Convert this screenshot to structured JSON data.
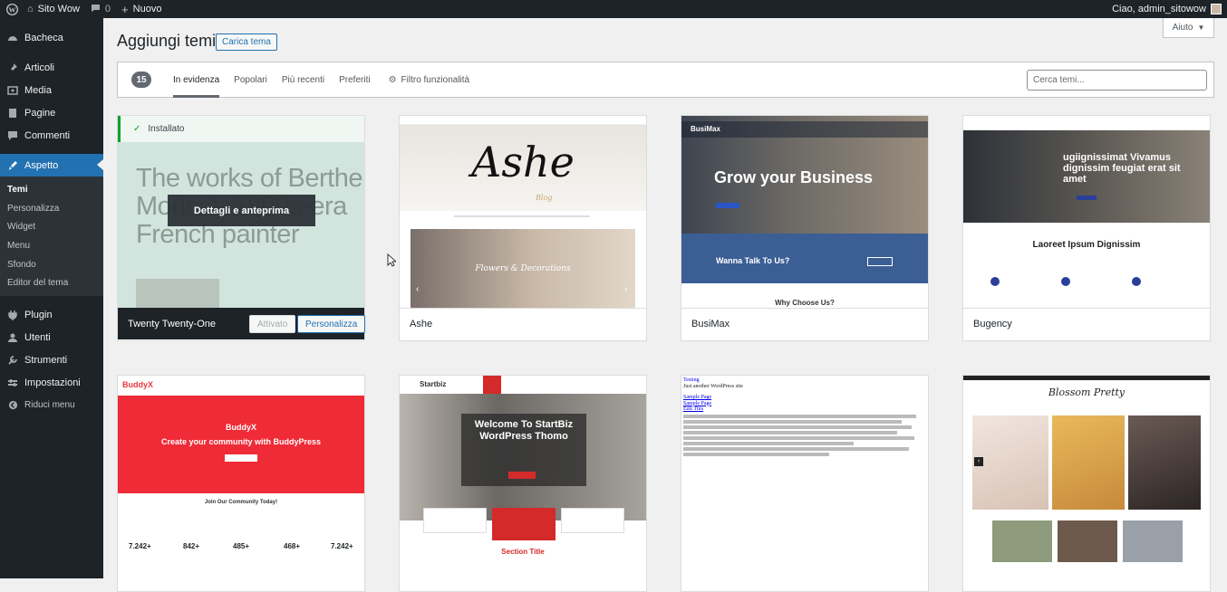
{
  "adminbar": {
    "site_name": "Sito Wow",
    "comments_count": "0",
    "new_label": "Nuovo",
    "greeting": "Ciao, admin_sitowow"
  },
  "sidebar": {
    "items": [
      {
        "label": "Bacheca",
        "icon": "dashboard-icon"
      },
      {
        "label": "Articoli",
        "icon": "pin-icon"
      },
      {
        "label": "Media",
        "icon": "media-icon"
      },
      {
        "label": "Pagine",
        "icon": "pages-icon"
      },
      {
        "label": "Commenti",
        "icon": "comments-icon"
      },
      {
        "label": "Aspetto",
        "icon": "appearance-icon"
      },
      {
        "label": "Plugin",
        "icon": "plugin-icon"
      },
      {
        "label": "Utenti",
        "icon": "users-icon"
      },
      {
        "label": "Strumenti",
        "icon": "tools-icon"
      },
      {
        "label": "Impostazioni",
        "icon": "settings-icon"
      },
      {
        "label": "Riduci menu",
        "icon": "collapse-icon"
      }
    ],
    "submenu": [
      "Temi",
      "Personalizza",
      "Widget",
      "Menu",
      "Sfondo",
      "Editor del tema"
    ]
  },
  "header": {
    "title": "Aggiungi temi",
    "upload_label": "Carica tema",
    "help_label": "Aiuto"
  },
  "filters": {
    "count": "15",
    "tabs": [
      "In evidenza",
      "Popolari",
      "Più recenti",
      "Preferiti"
    ],
    "feature_filter": "Filtro funzionalità",
    "search_placeholder": "Cerca temi..."
  },
  "themes": [
    {
      "name": "Twenty Twenty-One",
      "installed_label": "Installato",
      "details_label": "Dettagli e anteprima",
      "hero_text": "The works of Berthe Morisot, 1800s-era French painter",
      "activated_label": "Attivato",
      "customize_label": "Personalizza"
    },
    {
      "name": "Ashe",
      "logo": "Ashe",
      "logo_sub": "Blog",
      "banner": "Flowers & Decorations"
    },
    {
      "name": "BusiMax",
      "logo": "BusiMax",
      "hero": "Grow your Business",
      "cta": "Wanna Talk To Us?",
      "section": "Why Choose Us?"
    },
    {
      "name": "Bugency",
      "hero": "ugiignissimat Vivamus dignissim feugiat erat sit amet",
      "section": "Laoreet Ipsum Dignissim"
    },
    {
      "name": "BuddyX",
      "logo": "BuddyX",
      "hero_title": "BuddyX",
      "hero_sub": "Create your community with BuddyPress",
      "join": "Join Our Community Today!",
      "stats": [
        "7.242+",
        "842+",
        "485+",
        "468+",
        "7.242+"
      ]
    },
    {
      "name": "StartBiz",
      "logo": "Startbiz",
      "hero": "Welcome To StartBiz WordPress Thomo",
      "section": "Section Title"
    },
    {
      "name": "Testing",
      "site_title": "Testing",
      "tagline": "Just another WordPress site",
      "links": [
        "Sample Page",
        "Sample Page",
        "Edit This"
      ]
    },
    {
      "name": "Blossom Pretty",
      "logo": "Blossom Pretty"
    }
  ]
}
